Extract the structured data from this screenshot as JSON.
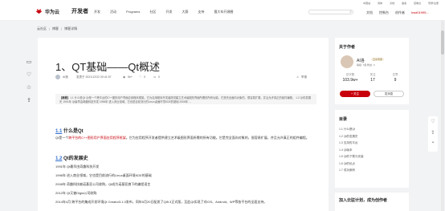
{
  "header": {
    "brand": "华为云",
    "section": "开发者",
    "nav": [
      "开发",
      "活动",
      "Programs",
      "社区",
      "开发",
      "大赛",
      "支持",
      "擅大伙开源圈"
    ],
    "top_links": [
      "中国站",
      "简体",
      "文档",
      "备案",
      "控制台",
      "登录/注册"
    ],
    "secondary": [
      "文档",
      "控制台",
      "创作者",
      "hwd01995..."
    ]
  },
  "breadcrumb": [
    "云社区",
    "博客",
    "博客详情"
  ],
  "left_tools": [
    "comment-icon",
    "like-icon",
    "collect-icon",
    "share-icon"
  ],
  "article": {
    "title": "1、QT基础——Qt概述",
    "author": "AI洛",
    "published": "发表于 2021/12/22 00:41:57",
    "views": "5e+",
    "likes": "0",
    "comments": "0",
    "report": "举报",
    "summary_label": "【摘要】",
    "summary": "1.1 什么是Qt Qt是一个跨平台的C++图形用户界面应用程序框架。它为应用程序开发者提供建立艺术级图形界面所需的所有功能。它是完全面向对象的，很容易扩展，并且允许真正的组件编程。 1.2 Qt的发展史 1991年 Qt最早由奇趣科技开发 1996年 进入商业领域，它也是目前流行的Linux桌面环境KDE的基础 2008年 ...",
    "sections": [
      {
        "num": "1.1",
        "title": " 什么是Qt"
      },
      {
        "num": "1.2",
        "title": " Qt的发展史"
      }
    ],
    "intro_pre": "Qt是一个",
    "intro_hl": "跨平台的C++图形用户界面应用程序框架",
    "intro_post": "。它为应用程序开发者提供建立艺术级图形界面所需的所有功能。它是完全面向对象的，很容易扩展，并且允许真正的组件编程。",
    "history": [
      "1991年 Qt最早由奇趣科技开发",
      "1996年 进入商业领域，它也是目前流行的Linux桌面环境KDE的基础",
      "2008年 奇趣科技被诺基亚公司收购，Qt成为诺基亚旗下的编程语言",
      "2012年 Qt又被Digia公司收购",
      "2014年4月 跨平台的集成开发环境Qt Creator3.1.0发布，同年5月20日配发了Qt5.3正式版，至此Qt实现了对iOS、Android、WP等各平台的全面支持。"
    ]
  },
  "author_card": {
    "heading": "关于作者",
    "name": "AI洛",
    "badge": "云享专家",
    "sub": "等级: 7级   粉丝: 0",
    "stats": [
      {
        "k": "总字数",
        "v": "103.9w+"
      },
      {
        "k": "关注",
        "v": "17"
      },
      {
        "k": "文章",
        "v": "9"
      }
    ],
    "follow": "+ 关注",
    "message": "发消息"
  },
  "toc": {
    "heading": "目录",
    "items": [
      "1.1 什么是Qt",
      "1.2 Qt的发展史",
      "1.3 支持的平台",
      "1.4 Qt版本",
      "1.5 Qt的下载与安装",
      "1.6 Qt的优点",
      "1.7 成功案例"
    ]
  },
  "join": {
    "heading": "加入云驻计划，成为创作者"
  },
  "right_tools": [
    "like-icon",
    "share-icon",
    "top-icon"
  ]
}
